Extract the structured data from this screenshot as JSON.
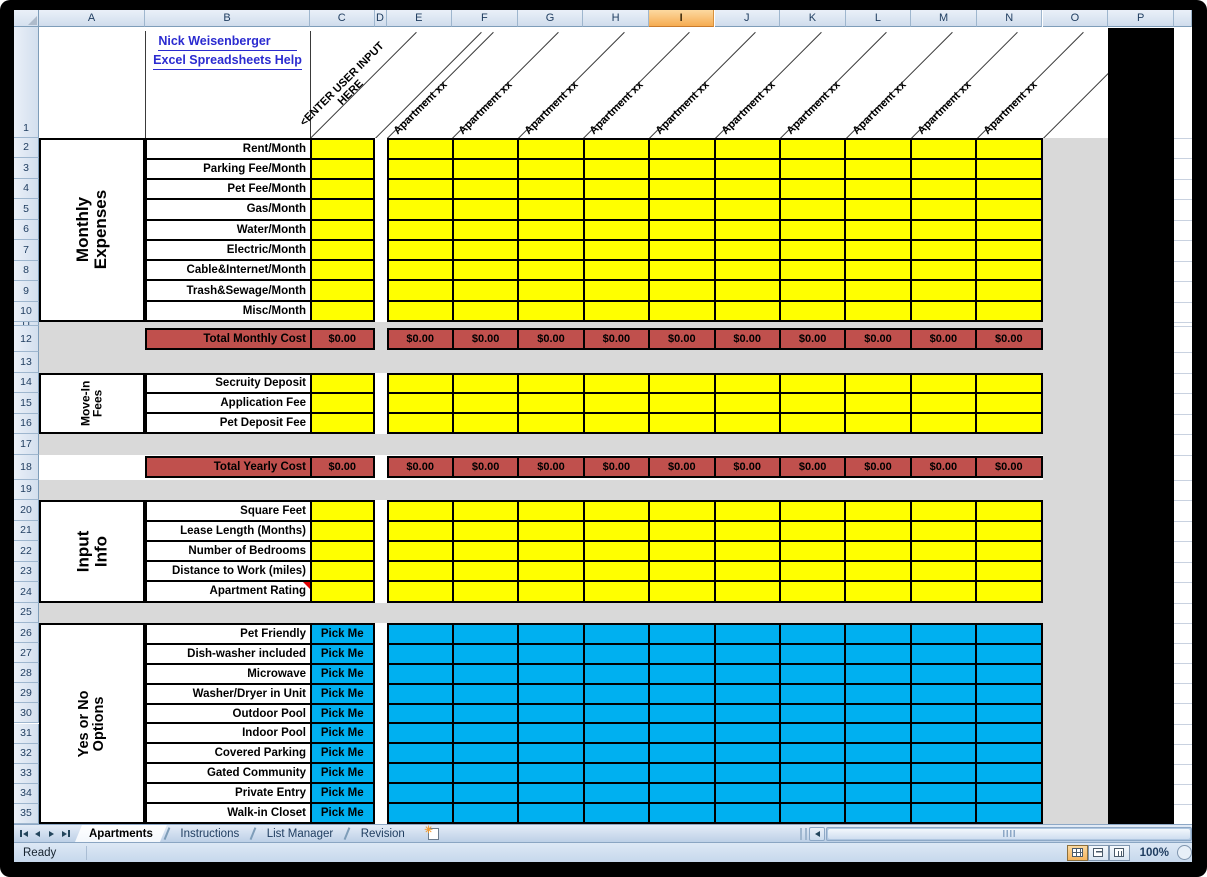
{
  "sheet": {
    "links": {
      "line1": "Nick Weisenberger",
      "line2": "Excel Spreadsheets Help"
    },
    "column_headers": [
      "A",
      "B",
      "C",
      "D",
      "E",
      "F",
      "G",
      "H",
      "I",
      "J",
      "K",
      "L",
      "M",
      "N",
      "O",
      "P"
    ],
    "selected_column": "I",
    "first_row": 1,
    "last_row": 35,
    "diagonal_header": {
      "input_label": "<ENTER USER INPUT\nHERE",
      "apartment_label": "Apartment xx",
      "apartment_count": 10
    },
    "groups": [
      {
        "label": "Monthly\nExpenses",
        "items": [
          "Rent/Month",
          "Parking Fee/Month",
          "Pet Fee/Month",
          "Gas/Month",
          "Water/Month",
          "Electric/Month",
          "Cable&Internet/Month",
          "Trash&Sewage/Month",
          "Misc/Month"
        ],
        "cell_style": "input",
        "cell_text": ""
      },
      {
        "label": "Move-In\nFees",
        "items": [
          "Secruity Deposit",
          "Application Fee",
          "Pet Deposit Fee"
        ],
        "cell_style": "input",
        "cell_text": ""
      },
      {
        "label": "Input\nInfo",
        "items": [
          "Square Feet",
          "Lease Length (Months)",
          "Number of Bedrooms",
          "Distance to Work (miles)",
          "Apartment Rating"
        ],
        "cell_style": "input",
        "cell_text": ""
      },
      {
        "label": "Yes or No Options",
        "items": [
          "Pet Friendly",
          "Dish-washer included",
          "Microwave",
          "Washer/Dryer in Unit",
          "Outdoor Pool",
          "Indoor Pool",
          "Covered Parking",
          "Gated Community",
          "Private Entry",
          "Walk-in Closet"
        ],
        "cell_style": "option",
        "cell_text": "Pick Me"
      }
    ],
    "comment_marker": {
      "group": 2,
      "item": 4
    },
    "totals": [
      {
        "label": "Total Monthly Cost",
        "value": "$0.00"
      },
      {
        "label": "Total Yearly Cost",
        "value": "$0.00"
      }
    ]
  },
  "tabs": {
    "sheets": [
      {
        "label": "Apartments",
        "active": true
      },
      {
        "label": "Instructions",
        "active": false
      },
      {
        "label": "List Manager",
        "active": false
      },
      {
        "label": "Revision",
        "active": false
      }
    ]
  },
  "status": {
    "mode": "Ready",
    "zoom_level": "100%"
  },
  "colors": {
    "input_cell": "#FFFF00",
    "total_cell": "#C0504D",
    "option_cell": "#00B0F0",
    "band": "#D9D9D9",
    "link": "#2B2BD0"
  }
}
